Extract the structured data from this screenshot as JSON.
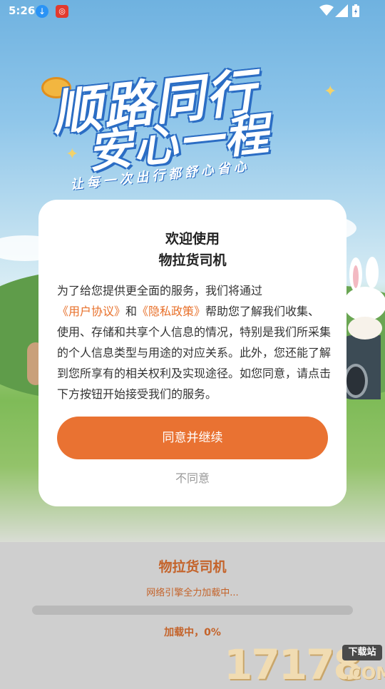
{
  "status_bar": {
    "time": "5:26",
    "icons": [
      "download-icon",
      "app-notification-icon",
      "wifi-icon",
      "signal-icon",
      "battery-icon"
    ]
  },
  "splash": {
    "slogan_line1": "顺路同行",
    "slogan_line2": "安心一程",
    "tagline": "让每一次出行都舒心省心"
  },
  "dialog": {
    "title_line1": "欢迎使用",
    "title_line2": "物拉货司机",
    "body_part1": "为了给您提供更全面的服务，我们将通过",
    "link_user_agreement": "《用户协议》",
    "body_part2": "和",
    "link_privacy_policy": "《隐私政策》",
    "body_part3": "帮助您了解我们收集、使用、存储和共享个人信息的情况，特别是我们所采集的个人信息类型与用途的对应关系。此外，您还能了解到您所享有的相关权利及实现途径。如您同意，请点击下方按钮开始接受我们的服务。",
    "agree_label": "同意并继续",
    "disagree_label": "不同意"
  },
  "loading": {
    "app_name": "物拉货司机",
    "subtitle": "网络引擎全力加载中...",
    "progress_percent": 0,
    "status": "加载中，0%"
  },
  "watermark": {
    "number": "17178",
    "tag": "下载站",
    "domain": ".COM"
  },
  "colors": {
    "accent": "#e97232",
    "link": "#e8702a",
    "loading_text": "#c4632a"
  }
}
